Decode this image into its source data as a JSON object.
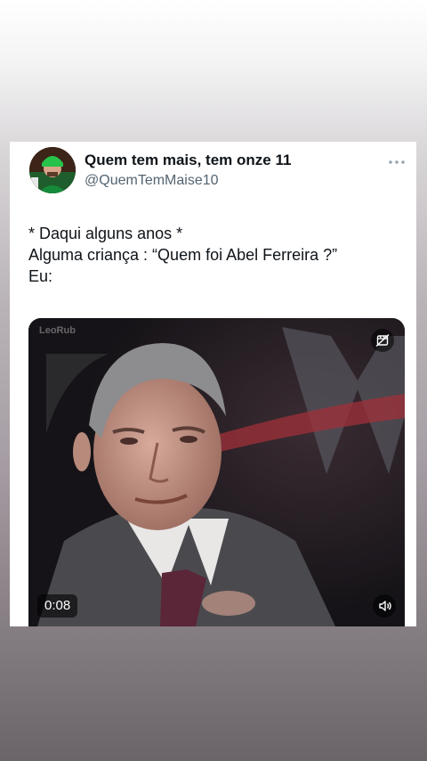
{
  "tweet": {
    "display_name": "Quem tem mais, tem onze 11",
    "handle": "@QuemTemMaise10",
    "text_lines": [
      "* Daqui alguns anos *",
      "Alguma criança : “Quem foi Abel Ferreira ?”",
      "Eu:"
    ]
  },
  "media": {
    "watermark": "LeoRub",
    "duration": "0:08"
  },
  "icons": {
    "more": "more-horizontal-icon",
    "gif_toggle": "animation-off-icon",
    "sound": "speaker-icon"
  },
  "colors": {
    "text_primary": "#0f1419",
    "text_secondary": "#536471",
    "card_background": "#ffffff"
  }
}
